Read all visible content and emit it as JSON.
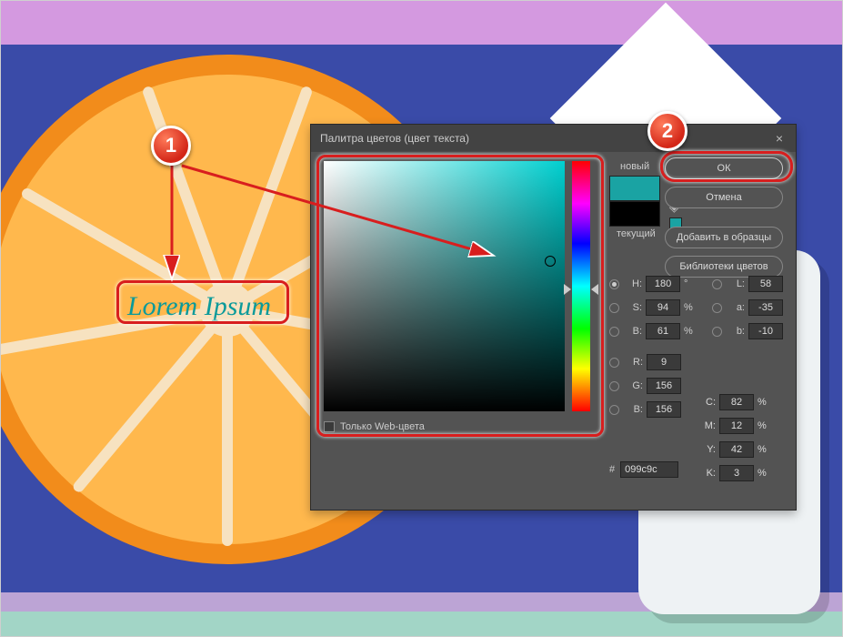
{
  "canvas": {
    "sample_text": "Lorem Ipsum"
  },
  "annotations": {
    "badge1": "1",
    "badge2": "2"
  },
  "dialog": {
    "title": "Палитра цветов (цвет текста)",
    "buttons": {
      "ok": "ОК",
      "cancel": "Отмена",
      "add_swatch": "Добавить в образцы",
      "libraries": "Библиотеки цветов"
    },
    "swatches": {
      "new_label": "новый",
      "current_label": "текущий",
      "new_color": "#1aa3a3",
      "current_color": "#000000"
    },
    "web_only_label": "Только Web-цвета",
    "web_only_checked": false,
    "hsb": {
      "H": "180",
      "H_unit": "°",
      "S": "94",
      "S_unit": "%",
      "B": "61",
      "B_unit": "%"
    },
    "lab": {
      "L": "58",
      "a": "-35",
      "b": "-10"
    },
    "rgb": {
      "R": "9",
      "G": "156",
      "B": "156"
    },
    "cmyk": {
      "C": "82",
      "M": "12",
      "Y": "42",
      "K": "3"
    },
    "hex": "099c9c",
    "selected_radio": "H"
  }
}
